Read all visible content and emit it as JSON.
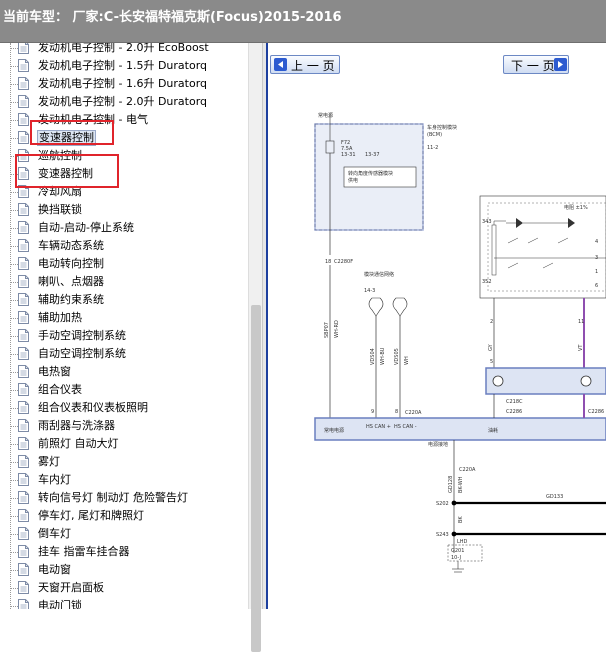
{
  "title": "当前车型： 厂家:C-长安福特福克斯(Focus)2015-2016",
  "tree": {
    "items": [
      {
        "label": "发动机电子控制 - 2.0升 EcoBoost"
      },
      {
        "label": "发动机电子控制 - 1.5升 Duratorq"
      },
      {
        "label": "发动机电子控制 - 1.6升 Duratorq"
      },
      {
        "label": "发动机电子控制 - 2.0升 Duratorq"
      },
      {
        "label": "发动机电子控制 - 电气"
      },
      {
        "label": "变速器控制"
      },
      {
        "label": "巡航控制"
      },
      {
        "label": "变速器控制"
      },
      {
        "label": "冷却风扇"
      },
      {
        "label": "换挡联锁"
      },
      {
        "label": "自动-启动-停止系统"
      },
      {
        "label": "车辆动态系统"
      },
      {
        "label": "电动转向控制"
      },
      {
        "label": "喇叭、点烟器"
      },
      {
        "label": "辅助约束系统"
      },
      {
        "label": "辅助加热"
      },
      {
        "label": "手动空调控制系统"
      },
      {
        "label": "自动空调控制系统"
      },
      {
        "label": "电热窗"
      },
      {
        "label": "组合仪表"
      },
      {
        "label": "组合仪表和仪表板照明"
      },
      {
        "label": "雨刮器与洗涤器"
      },
      {
        "label": "前照灯 自动大灯"
      },
      {
        "label": "雾灯"
      },
      {
        "label": "车内灯"
      },
      {
        "label": "转向信号灯 制动灯 危险警告灯"
      },
      {
        "label": "停车灯, 尾灯和牌照灯"
      },
      {
        "label": "倒车灯"
      },
      {
        "label": "挂车 指雷车挂合器"
      },
      {
        "label": "电动窗"
      },
      {
        "label": "天窗开启面板"
      },
      {
        "label": "电动门锁"
      }
    ]
  },
  "viewer": {
    "prev_label": "上 一 页",
    "next_label": "下 一 页"
  },
  "diagram": {
    "labels": {
      "power": "常电源",
      "bcm": "车身控制模块",
      "bcm_en": "(BCM)",
      "fuse": "F72",
      "fuse_rating": "7.5A",
      "fuse_pins_left": "13-31",
      "fuse_pins_right": "13-37",
      "page_ref": "11-2",
      "module_note": "转向角度传感器模块",
      "module_note2": "供电",
      "conn_c2280f": "C2280F",
      "pin_18": "18",
      "wire_sbp07": "SBP07",
      "wire_wh_rd": "WH-RD",
      "can_note": "模块通信网络",
      "page_14_3": "14-3",
      "wire_vds04": "VDS04",
      "wire_wh_bu": "WH-BU",
      "wire_vds05": "VDS05",
      "wire_wh": "WH",
      "pin_9": "9",
      "pin_8": "8",
      "conn_c220a": "C220A",
      "hs_can_plus": "HS CAN +",
      "hs_can_minus": "HS CAN -",
      "power_label": "常电电源",
      "gnd_label": "电源接地",
      "c2286": "C2286",
      "c2286b": "C2286",
      "c2180": "C218C",
      "sig1": "油耗",
      "relay_note": "电阻 ±1%",
      "r343": "343",
      "r352": "352",
      "pin_2": "2",
      "pin_11": "11",
      "pin_5": "5",
      "wire_gy": "GY",
      "wire_vt": "VT",
      "gd133": "GD133",
      "wire_bk_wh": "BK-WH",
      "s202": "S202",
      "s243": "S243",
      "gd128": "GD128",
      "wire_bk": "BK",
      "lhd": "LHD",
      "g201": "G201",
      "g201_page": "10-J",
      "c220a2": "C220A",
      "pin_4": "4",
      "pin_1": "1",
      "pin_3": "3",
      "pin_6": "6"
    }
  },
  "colors": {
    "titlebar": "#8a8a8a",
    "highlight_box": "#e0242b",
    "viewer_border": "#1d3f9e",
    "module_fill": "#dde4f3",
    "module_border": "#6a7fbf"
  }
}
